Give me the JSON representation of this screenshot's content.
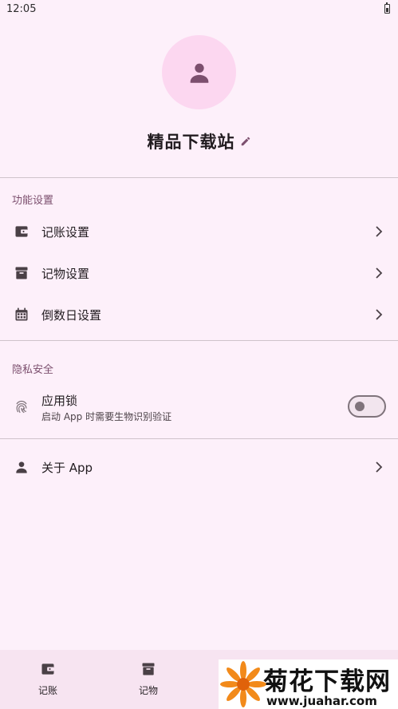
{
  "status_bar": {
    "time": "12:05",
    "icons": [
      "battery-icon"
    ]
  },
  "profile": {
    "name": "精品下载站",
    "avatar_icon": "person-icon",
    "edit_icon": "pencil-icon"
  },
  "sections": {
    "features": {
      "title": "功能设置",
      "items": [
        {
          "label": "记账设置",
          "icon": "wallet-icon"
        },
        {
          "label": "记物设置",
          "icon": "archive-box-icon"
        },
        {
          "label": "倒数日设置",
          "icon": "calendar-icon"
        }
      ]
    },
    "privacy": {
      "title": "隐私安全",
      "app_lock": {
        "title": "应用锁",
        "subtitle": "启动 App 时需要生物识别验证",
        "icon": "fingerprint-icon",
        "enabled": false
      }
    },
    "about": {
      "label": "关于 App",
      "icon": "person-icon"
    }
  },
  "bottom_nav": [
    {
      "label": "记账",
      "icon": "wallet-icon"
    },
    {
      "label": "记物",
      "icon": "archive-box-icon"
    }
  ],
  "watermark": {
    "title": "菊花下载网",
    "url": "www.juahar.com"
  },
  "colors": {
    "background": "#fdf0fa",
    "avatar_bg": "#fcd7f0",
    "accent": "#7c4f6e",
    "icon": "#4a4046",
    "nav_bg": "#f7e4f1"
  }
}
